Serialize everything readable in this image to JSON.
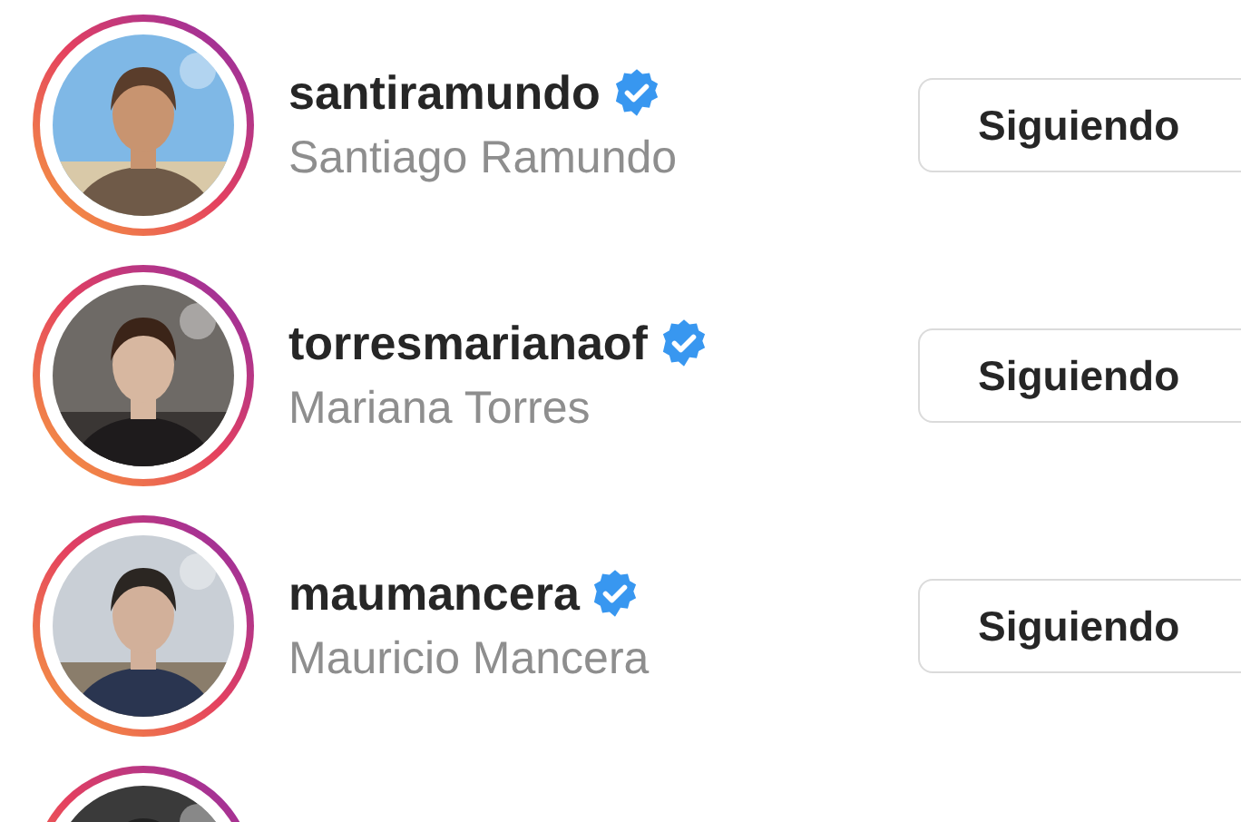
{
  "accounts": [
    {
      "avatar": {
        "kind": "picture"
      },
      "username": "santiramundo",
      "verified": true,
      "full_name": "Santiago Ramundo",
      "button": "Siguiendo"
    },
    {
      "avatar": {
        "kind": "picture"
      },
      "username": "torresmarianaof",
      "verified": true,
      "full_name": "Mariana Torres",
      "button": "Siguiendo"
    },
    {
      "avatar": {
        "kind": "picture"
      },
      "username": "maumancera",
      "verified": true,
      "full_name": "Mauricio Mancera",
      "button": "Siguiendo"
    },
    {
      "avatar": {
        "kind": "picture"
      }
    }
  ]
}
